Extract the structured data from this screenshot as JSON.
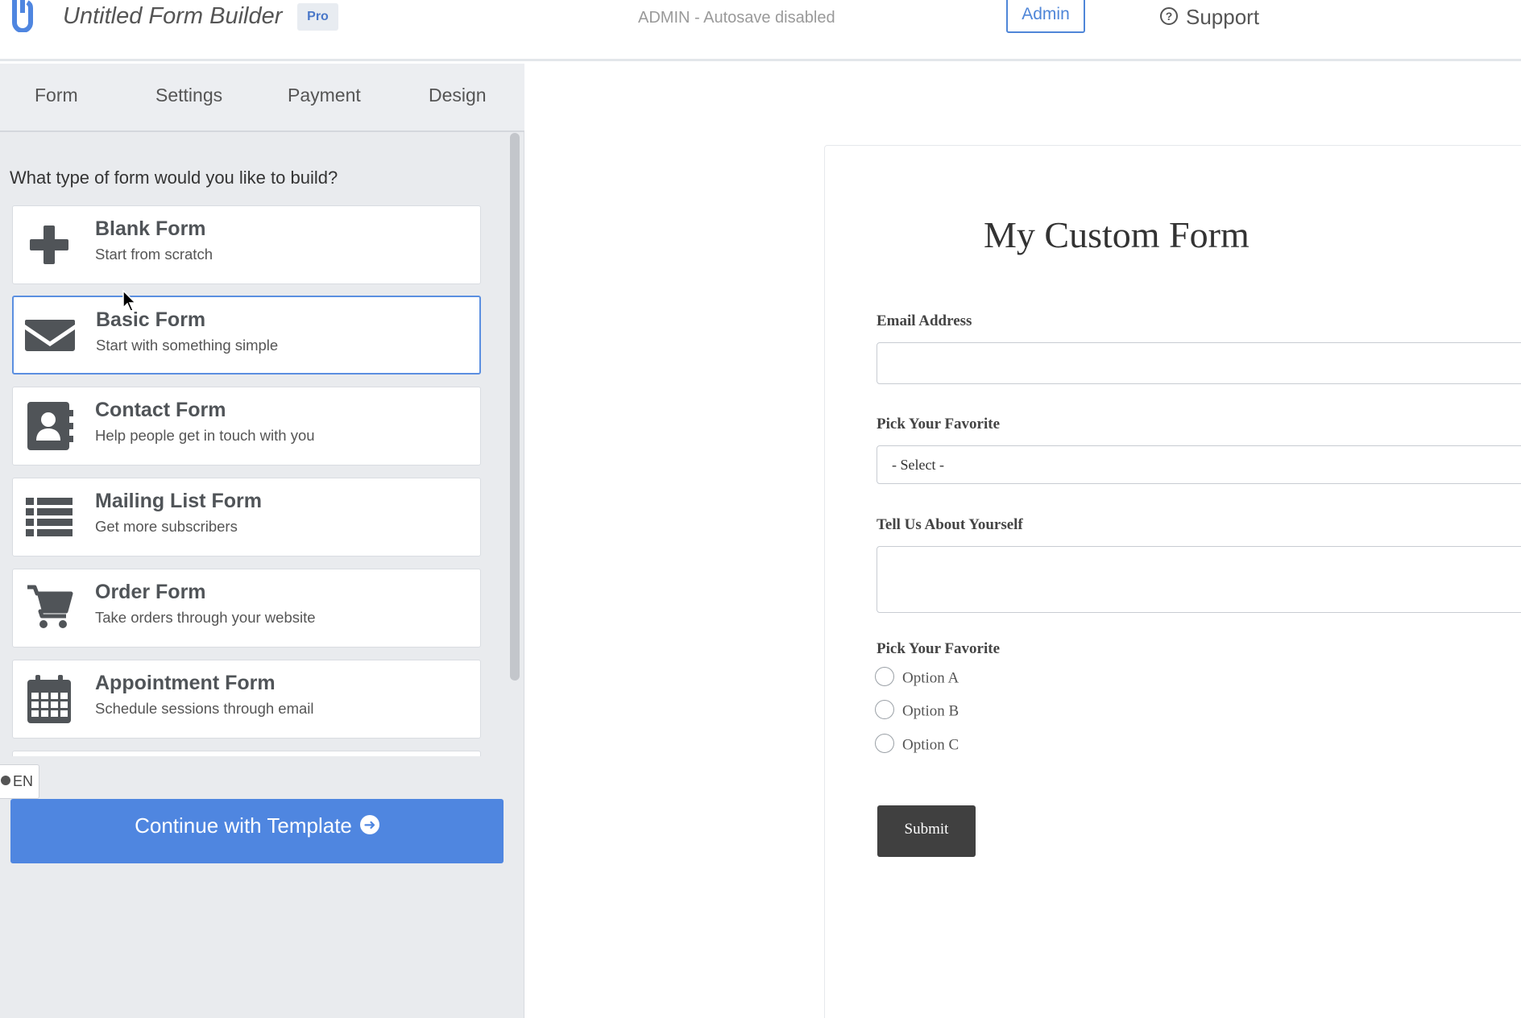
{
  "header": {
    "app_title": "Untitled Form Builder",
    "badge": "Pro",
    "autosave_status": "ADMIN - Autosave disabled",
    "admin_button": "Admin",
    "support_link": "Support"
  },
  "tabs": [
    {
      "label": "Form"
    },
    {
      "label": "Settings"
    },
    {
      "label": "Payment"
    },
    {
      "label": "Design"
    }
  ],
  "template_picker": {
    "question": "What type of form would you like to build?",
    "selected_index": 1,
    "templates": [
      {
        "title": "Blank Form",
        "subtitle": "Start from scratch",
        "icon": "plus-icon"
      },
      {
        "title": "Basic Form",
        "subtitle": "Start with something simple",
        "icon": "envelope-icon"
      },
      {
        "title": "Contact Form",
        "subtitle": "Help people get in touch with you",
        "icon": "address-book-icon"
      },
      {
        "title": "Mailing List Form",
        "subtitle": "Get more subscribers",
        "icon": "list-icon"
      },
      {
        "title": "Order Form",
        "subtitle": "Take orders through your website",
        "icon": "cart-icon"
      },
      {
        "title": "Appointment Form",
        "subtitle": "Schedule sessions through email",
        "icon": "calendar-icon"
      }
    ]
  },
  "language": "EN",
  "continue_button": "Continue with Template",
  "preview": {
    "title": "My Custom Form",
    "email_label": "Email Address",
    "select_label": "Pick Your Favorite",
    "select_value": "- Select -",
    "textarea_label": "Tell Us About Yourself",
    "radio_label": "Pick Your Favorite",
    "radio_options": [
      "Option A",
      "Option B",
      "Option C"
    ],
    "submit": "Submit"
  },
  "colors": {
    "accent": "#4f86e0",
    "panel_bg": "#e9ebee",
    "icon_gray": "#505458",
    "submit_bg": "#404040"
  }
}
